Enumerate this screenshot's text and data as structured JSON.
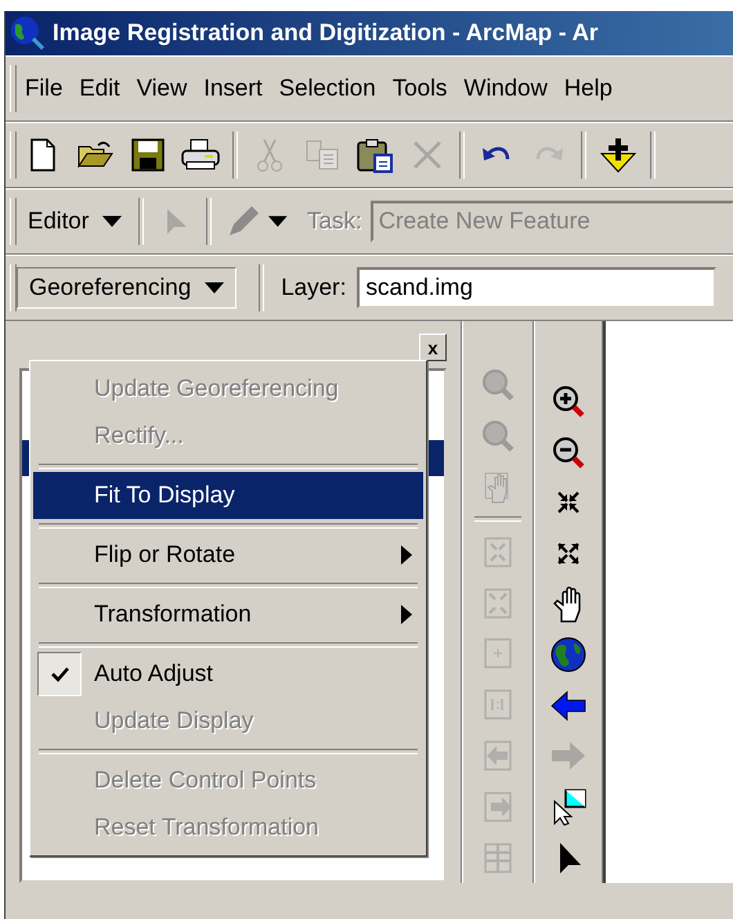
{
  "window": {
    "title": "Image Registration and Digitization - ArcMap - Ar"
  },
  "menu_bar": [
    {
      "label": "File"
    },
    {
      "label": "Edit"
    },
    {
      "label": "View"
    },
    {
      "label": "Insert"
    },
    {
      "label": "Selection"
    },
    {
      "label": "Tools"
    },
    {
      "label": "Window"
    },
    {
      "label": "Help"
    }
  ],
  "standard_toolbar": [
    {
      "kind": "button",
      "disabled": false
    },
    {
      "kind": "button",
      "disabled": false
    },
    {
      "kind": "button",
      "disabled": false
    },
    {
      "kind": "button",
      "disabled": false
    },
    {
      "kind": "separator"
    },
    {
      "kind": "button",
      "disabled": true
    },
    {
      "kind": "button",
      "disabled": true
    },
    {
      "kind": "button",
      "disabled": false
    },
    {
      "kind": "button",
      "disabled": true
    },
    {
      "kind": "separator"
    },
    {
      "kind": "button",
      "disabled": false
    },
    {
      "kind": "button",
      "disabled": true
    },
    {
      "kind": "separator"
    },
    {
      "kind": "button",
      "disabled": false
    },
    {
      "kind": "separator"
    }
  ],
  "editor_toolbar": {
    "editor_menu": {
      "label": "Editor"
    },
    "edit_tool": {
      "disabled": true
    },
    "sketch_tool": {
      "disabled": true
    },
    "task_label": "Task:",
    "task_value": "Create New Feature",
    "task_disabled": true
  },
  "georeferencing_toolbar": {
    "menu_button": {
      "label": "Georeferencing",
      "expanded": true
    },
    "layer_label": "Layer:",
    "layer_value": "scand.img"
  },
  "georeferencing_menu": [
    {
      "kind": "item",
      "label": "Update Georeferencing",
      "disabled": true,
      "selected": false,
      "checked": false,
      "submenu": false
    },
    {
      "kind": "item",
      "label": "Rectify...",
      "disabled": true,
      "selected": false,
      "checked": false,
      "submenu": false
    },
    {
      "kind": "separator"
    },
    {
      "kind": "item",
      "label": "Fit To Display",
      "disabled": false,
      "selected": true,
      "checked": false,
      "submenu": false
    },
    {
      "kind": "separator"
    },
    {
      "kind": "item",
      "label": "Flip or Rotate",
      "disabled": false,
      "selected": false,
      "checked": false,
      "submenu": true
    },
    {
      "kind": "separator"
    },
    {
      "kind": "item",
      "label": "Transformation",
      "disabled": false,
      "selected": false,
      "checked": false,
      "submenu": true
    },
    {
      "kind": "separator"
    },
    {
      "kind": "item",
      "label": "Auto Adjust",
      "disabled": false,
      "selected": false,
      "checked": true,
      "submenu": false
    },
    {
      "kind": "item",
      "label": "Update Display",
      "disabled": true,
      "selected": false,
      "checked": false,
      "submenu": false
    },
    {
      "kind": "separator"
    },
    {
      "kind": "item",
      "label": "Delete Control Points",
      "disabled": true,
      "selected": false,
      "checked": false,
      "submenu": false
    },
    {
      "kind": "item",
      "label": "Reset Transformation",
      "disabled": true,
      "selected": false,
      "checked": false,
      "submenu": false
    }
  ],
  "table_of_contents": {
    "close_button": "x",
    "rows": [
      {
        "selected": false
      },
      {
        "selected": true
      }
    ]
  },
  "georeferencing_tools": [
    {
      "kind": "button",
      "disabled": true
    },
    {
      "kind": "button",
      "disabled": true
    },
    {
      "kind": "button",
      "disabled": true
    },
    {
      "kind": "separator"
    },
    {
      "kind": "button",
      "disabled": true
    },
    {
      "kind": "button",
      "disabled": true
    },
    {
      "kind": "button",
      "disabled": true
    },
    {
      "kind": "button",
      "disabled": true
    },
    {
      "kind": "button",
      "disabled": true
    },
    {
      "kind": "button",
      "disabled": true
    },
    {
      "kind": "button",
      "disabled": true
    }
  ],
  "tools_toolbar": [
    {
      "kind": "button",
      "disabled": false
    },
    {
      "kind": "button",
      "disabled": false
    },
    {
      "kind": "button",
      "disabled": false
    },
    {
      "kind": "button",
      "disabled": false
    },
    {
      "kind": "button",
      "disabled": false
    },
    {
      "kind": "button",
      "disabled": false
    },
    {
      "kind": "button",
      "disabled": false
    },
    {
      "kind": "button",
      "disabled": true
    },
    {
      "kind": "button",
      "disabled": false
    },
    {
      "kind": "button",
      "disabled": false
    }
  ]
}
